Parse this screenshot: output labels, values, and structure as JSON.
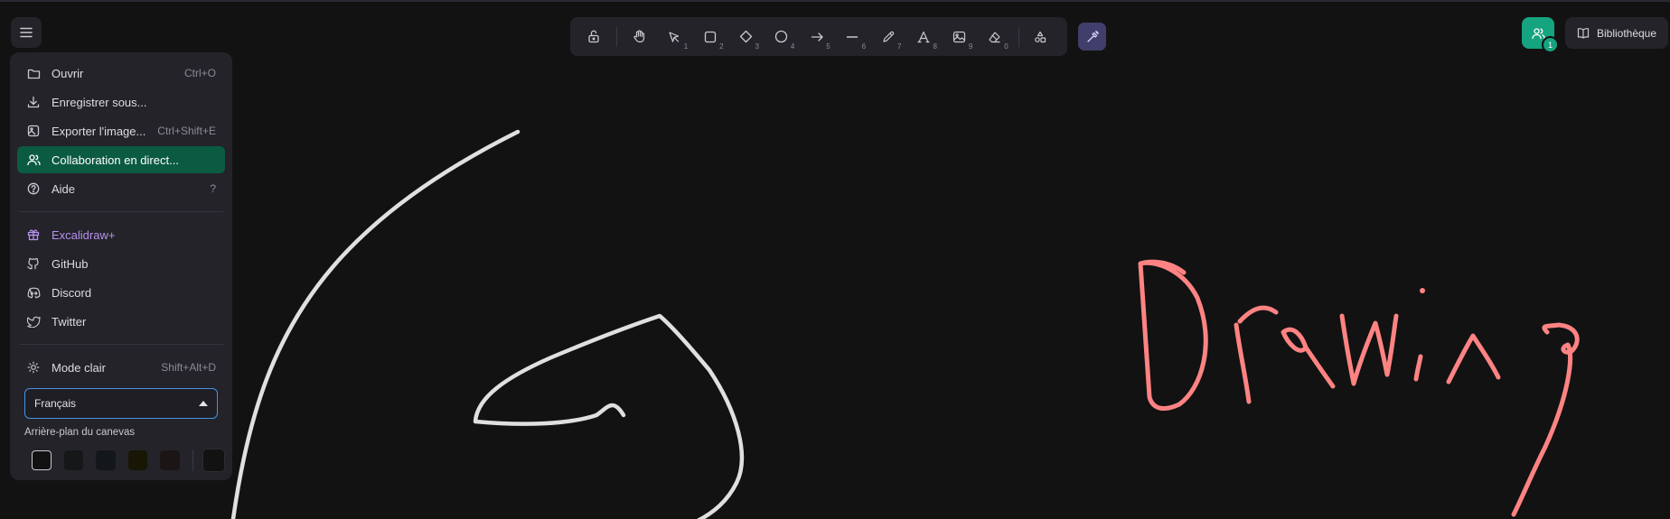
{
  "menu": {
    "items": [
      {
        "label": "Ouvrir",
        "shortcut": "Ctrl+O",
        "icon": "folder-icon"
      },
      {
        "label": "Enregistrer sous...",
        "shortcut": "",
        "icon": "download-icon"
      },
      {
        "label": "Exporter l'image...",
        "shortcut": "Ctrl+Shift+E",
        "icon": "export-image-icon"
      },
      {
        "label": "Collaboration en direct...",
        "shortcut": "",
        "icon": "users-icon"
      },
      {
        "label": "Aide",
        "shortcut": "?",
        "icon": "help-icon"
      }
    ],
    "links": [
      {
        "label": "Excalidraw+",
        "icon": "gift-icon"
      },
      {
        "label": "GitHub",
        "icon": "github-icon"
      },
      {
        "label": "Discord",
        "icon": "discord-icon"
      },
      {
        "label": "Twitter",
        "icon": "twitter-icon"
      }
    ],
    "theme": {
      "label": "Mode clair",
      "shortcut": "Shift+Alt+D",
      "icon": "sun-icon"
    },
    "language": {
      "value": "Français"
    },
    "canvas_background": {
      "title": "Arrière-plan du canevas",
      "swatches": [
        "#121212",
        "#161718",
        "#13171c",
        "#181605",
        "#1b1615"
      ],
      "custom": "#121212"
    }
  },
  "toolbar": {
    "tools": [
      {
        "name": "lock-icon",
        "key": ""
      },
      {
        "name": "hand-icon",
        "key": ""
      },
      {
        "name": "selection-icon",
        "key": "1"
      },
      {
        "name": "rectangle-icon",
        "key": "2"
      },
      {
        "name": "diamond-icon",
        "key": "3"
      },
      {
        "name": "ellipse-icon",
        "key": "4"
      },
      {
        "name": "arrow-icon",
        "key": "5"
      },
      {
        "name": "line-icon",
        "key": "6"
      },
      {
        "name": "pencil-icon",
        "key": "7"
      },
      {
        "name": "text-icon",
        "key": "8"
      },
      {
        "name": "image-icon",
        "key": "9"
      },
      {
        "name": "eraser-icon",
        "key": "0"
      },
      {
        "name": "shapes-icon",
        "key": ""
      }
    ],
    "extra_tool": "laser-pointer-icon"
  },
  "collaboration": {
    "count": "1"
  },
  "library": {
    "label": "Bibliothèque"
  },
  "colors": {
    "accent": "#16a37f",
    "active_menu": "#0b5b42",
    "stroke_light": "#e0e0e0",
    "stroke_pink": "#ff8383"
  }
}
